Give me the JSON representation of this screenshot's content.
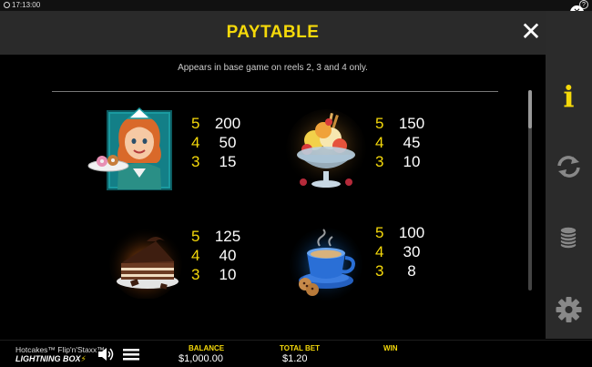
{
  "status_bar": {
    "time": "17:13:00",
    "help": "?"
  },
  "paytable": {
    "title": "PAYTABLE",
    "subtitle": "Appears in base game on reels 2, 3 and 4 only.",
    "close_glyph": "✕",
    "symbols": [
      {
        "name": "waitress",
        "pays": [
          {
            "count": "5",
            "amount": "200"
          },
          {
            "count": "4",
            "amount": "50"
          },
          {
            "count": "3",
            "amount": "15"
          }
        ]
      },
      {
        "name": "ice-cream-sundae",
        "pays": [
          {
            "count": "5",
            "amount": "150"
          },
          {
            "count": "4",
            "amount": "45"
          },
          {
            "count": "3",
            "amount": "10"
          }
        ]
      },
      {
        "name": "chocolate-cake",
        "pays": [
          {
            "count": "5",
            "amount": "125"
          },
          {
            "count": "4",
            "amount": "40"
          },
          {
            "count": "3",
            "amount": "10"
          }
        ]
      },
      {
        "name": "coffee-cup",
        "pays": [
          {
            "count": "5",
            "amount": "100"
          },
          {
            "count": "4",
            "amount": "30"
          },
          {
            "count": "3",
            "amount": "8"
          }
        ]
      }
    ]
  },
  "sidebar": {
    "info_glyph": "i",
    "items": [
      {
        "icon": "info-icon",
        "active": true
      },
      {
        "icon": "autoplay-icon",
        "active": false
      },
      {
        "icon": "coin-stack-icon",
        "active": false
      },
      {
        "icon": "gear-icon",
        "active": false
      }
    ]
  },
  "bottom_bar": {
    "game_name": "Hotcakes™ Flip'n'Staxx™",
    "brand": "LIGHTNING BOX",
    "brand_mark": "⚡",
    "balance_label": "BALANCE",
    "balance_value": "$1,000.00",
    "total_bet_label": "TOTAL BET",
    "total_bet_value": "$1.20",
    "win_label": "WIN",
    "win_value": ""
  },
  "colors": {
    "accent": "#f5d90a",
    "header_bg": "#2a2a2a",
    "sidebar_bg": "#2b2b2b",
    "background": "#000000"
  }
}
